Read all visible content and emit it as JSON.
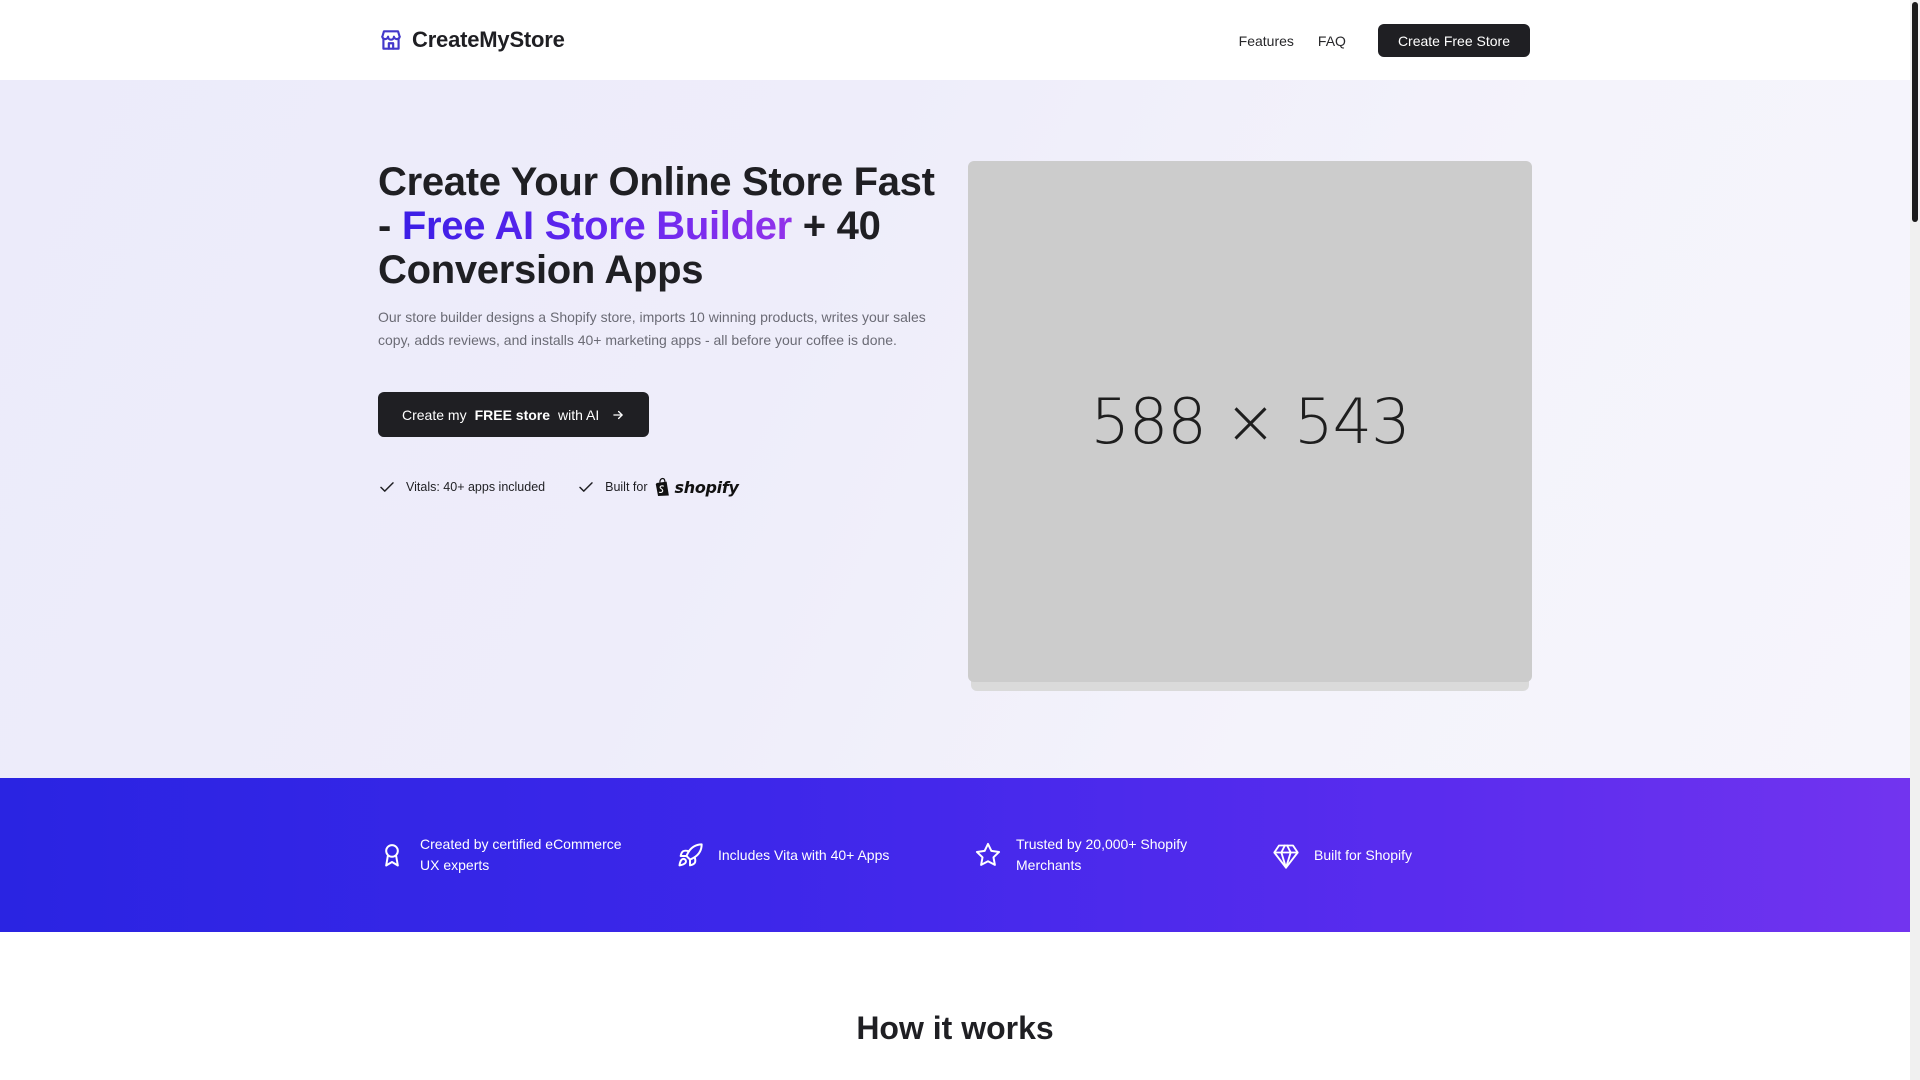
{
  "header": {
    "brand": "CreateMyStore",
    "nav": [
      "Features",
      "FAQ"
    ],
    "cta": "Create Free Store"
  },
  "hero": {
    "title_part1": "Create Your Online Store Fast - ",
    "title_highlight": "Free AI Store Builder",
    "title_part2": " + 40 Conversion Apps",
    "subtitle": "Our store builder designs a Shopify store, imports 10 winning products, writes your sales copy, adds reviews, and installs 40+ marketing apps - all before your coffee is done.",
    "cta_prefix": "Create my",
    "cta_bold": "FREE store",
    "cta_suffix": "with AI",
    "checks": [
      "Vitals: 40+ apps included",
      "Built for"
    ],
    "shopify_wordmark": "shopify",
    "image_placeholder": "588 × 543"
  },
  "features_band": [
    {
      "icon": "award-icon",
      "text": "Created by certified eCommerce UX experts"
    },
    {
      "icon": "rocket-icon",
      "text": "Includes Vita with 40+ Apps"
    },
    {
      "icon": "star-icon",
      "text": "Trusted by 20,000+ Shopify Merchants"
    },
    {
      "icon": "gem-icon",
      "text": "Built for Shopify"
    }
  ],
  "how_it_works": {
    "title": "How it works"
  },
  "colors": {
    "accent_start": "#3b1ee6",
    "accent_end": "#9333ea",
    "dark": "#1f1f23",
    "band_start": "#2a24e2",
    "band_end": "#7234ef"
  }
}
